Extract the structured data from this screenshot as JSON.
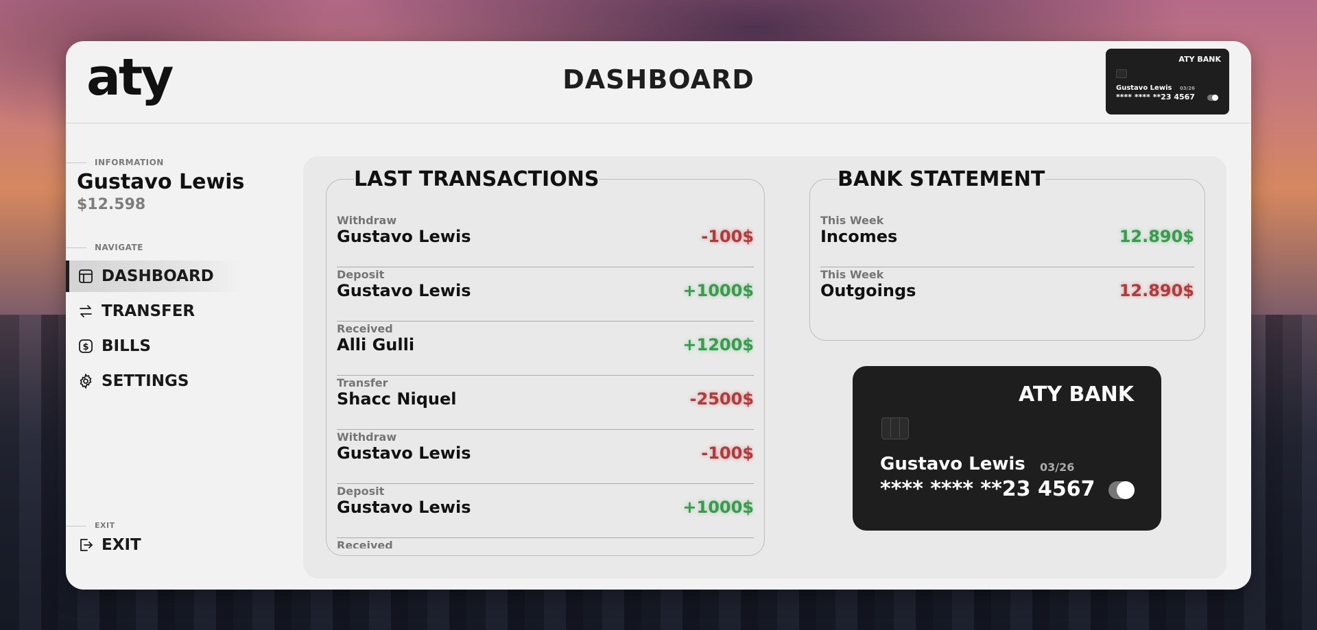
{
  "header": {
    "logo": "aty",
    "title": "DASHBOARD",
    "mini_card": {
      "bank": "ATY BANK",
      "holder": "Gustavo Lewis",
      "expiry": "03/26",
      "number": "**** **** **23 4567"
    }
  },
  "sidebar": {
    "info_label": "INFORMATION",
    "user_name": "Gustavo Lewis",
    "balance": "$12.598",
    "navigate_label": "NAVIGATE",
    "items": [
      {
        "label": "DASHBOARD",
        "icon": "layout-icon",
        "active": true
      },
      {
        "label": "TRANSFER",
        "icon": "arrows-swap-icon",
        "active": false
      },
      {
        "label": "BILLS",
        "icon": "dollar-icon",
        "active": false
      },
      {
        "label": "SETTINGS",
        "icon": "gear-icon",
        "active": false
      }
    ],
    "exit_label": "EXIT",
    "exit_item": "EXIT"
  },
  "transactions": {
    "title": "LAST TRANSACTIONS",
    "rows": [
      {
        "type": "Withdraw",
        "name": "Gustavo Lewis",
        "amount": "-100$",
        "sign": "neg"
      },
      {
        "type": "Deposit",
        "name": "Gustavo Lewis",
        "amount": "+1000$",
        "sign": "pos"
      },
      {
        "type": "Received",
        "name": "Alli Gulli",
        "amount": "+1200$",
        "sign": "pos"
      },
      {
        "type": "Transfer",
        "name": "Shacc Niquel",
        "amount": "-2500$",
        "sign": "neg"
      },
      {
        "type": "Withdraw",
        "name": "Gustavo Lewis",
        "amount": "-100$",
        "sign": "neg"
      },
      {
        "type": "Deposit",
        "name": "Gustavo Lewis",
        "amount": "+1000$",
        "sign": "pos"
      },
      {
        "type": "Received",
        "name": "",
        "amount": "",
        "sign": "pos"
      }
    ]
  },
  "statement": {
    "title": "BANK STATEMENT",
    "rows": [
      {
        "type": "This Week",
        "name": "Incomes",
        "amount": "12.890$",
        "sign": "pos"
      },
      {
        "type": "This Week",
        "name": "Outgoings",
        "amount": "12.890$",
        "sign": "neg"
      }
    ]
  },
  "card": {
    "bank": "ATY BANK",
    "holder": "Gustavo Lewis",
    "expiry": "03/26",
    "number": "**** **** **23 4567"
  },
  "colors": {
    "positive": "#3a9a4e",
    "negative": "#b23a3a",
    "card_bg": "#1e1e1e",
    "panel_bg": "#f2f2f2"
  }
}
